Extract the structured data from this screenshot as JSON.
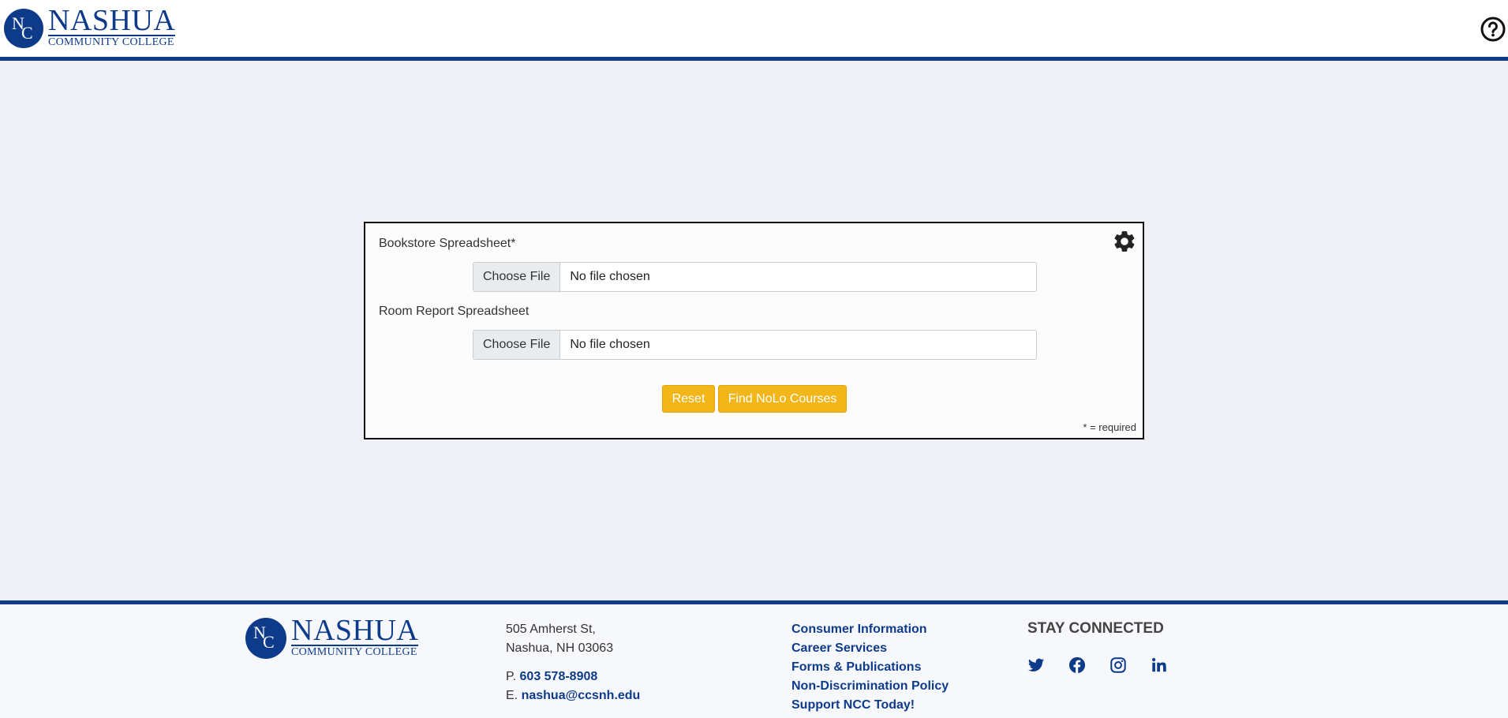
{
  "brand": {
    "seal_n": "N",
    "seal_c": "C",
    "name": "NASHUA",
    "subtitle": "COMMUNITY COLLEGE",
    "color": "#0d3b8a"
  },
  "header": {
    "help_icon": "question-circle-icon"
  },
  "form": {
    "settings_icon": "gear-icon",
    "bookstore_label": "Bookstore Spreadsheet*",
    "room_label": "Room Report Spreadsheet",
    "choose_file_label": "Choose File",
    "no_file_text": "No file chosen",
    "reset_label": "Reset",
    "find_label": "Find NoLo Courses",
    "required_note": "* = required",
    "button_color": "#f2b619"
  },
  "footer": {
    "address_line1": "505 Amherst St,",
    "address_line2": "Nashua, NH 03063",
    "phone_prefix": "P.",
    "phone": "603 578-8908",
    "email_prefix": "E.",
    "email": "nashua@ccsnh.edu",
    "links": [
      "Consumer Information",
      "Career Services",
      "Forms & Publications",
      "Non-Discrimination Policy",
      "Support NCC Today!"
    ],
    "stay_connected": "STAY CONNECTED",
    "social_icons": [
      "twitter-icon",
      "facebook-icon",
      "instagram-icon",
      "linkedin-icon"
    ]
  }
}
